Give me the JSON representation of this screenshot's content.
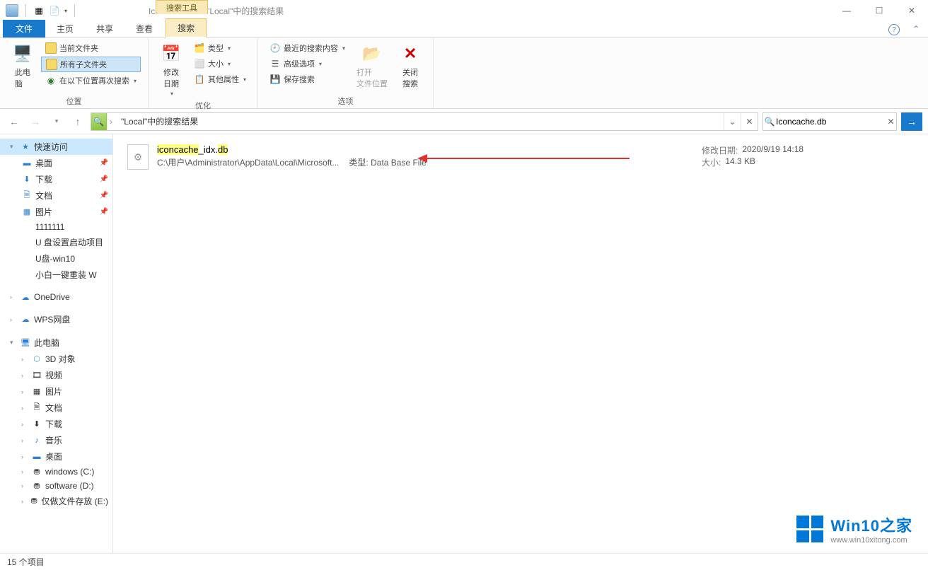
{
  "window": {
    "context_tab": "搜索工具",
    "title": "Iconcache.db - \"Local\"中的搜索结果",
    "controls": {
      "min": "—",
      "max": "☐",
      "close": "✕"
    }
  },
  "menu": {
    "file": "文件",
    "home": "主页",
    "share": "共享",
    "view": "查看",
    "search": "搜索"
  },
  "ribbon": {
    "group_location": {
      "this_pc": "此电\n脑",
      "current_folder": "当前文件夹",
      "all_subfolders": "所有子文件夹",
      "search_again_in": "在以下位置再次搜索",
      "label": "位置"
    },
    "group_refine": {
      "modify_date": "修改\n日期",
      "type": "类型",
      "size": "大小",
      "other_props": "其他属性",
      "label": "优化"
    },
    "group_options": {
      "recent": "最近的搜索内容",
      "advanced": "高级选项",
      "save": "保存搜索",
      "open_location": "打开\n文件位置",
      "close_search": "关闭\n搜索",
      "label": "选项"
    }
  },
  "nav": {
    "address": "\"Local\"中的搜索结果",
    "search_value": "Iconcache.db"
  },
  "sidebar": {
    "quick_access": "快速访问",
    "desktop": "桌面",
    "downloads": "下载",
    "documents": "文档",
    "pictures": "图片",
    "f1": "1111111",
    "f2": "U 盘设置启动项目",
    "f3": "U盘-win10",
    "f4": "小白一键重装 W",
    "onedrive": "OneDrive",
    "wps": "WPS网盘",
    "this_pc": "此电脑",
    "obj3d": "3D 对象",
    "videos": "视频",
    "pictures2": "图片",
    "documents2": "文档",
    "downloads2": "下载",
    "music": "音乐",
    "desktop2": "桌面",
    "drive_c": "windows (C:)",
    "drive_d": "software (D:)",
    "drive_e": "仅做文件存放 (E:)"
  },
  "result": {
    "name_hl": "iconcache",
    "name_mid": "_idx.",
    "name_ext": "db",
    "path": "C:\\用户\\Administrator\\AppData\\Local\\Microsoft...",
    "type_label": "类型:",
    "type_value": "Data Base File",
    "date_label": "修改日期:",
    "date_value": "2020/9/19 14:18",
    "size_label": "大小:",
    "size_value": "14.3 KB"
  },
  "status": {
    "items": "15 个项目"
  },
  "watermark": {
    "title": "Win10之家",
    "url": "www.win10xitong.com"
  }
}
